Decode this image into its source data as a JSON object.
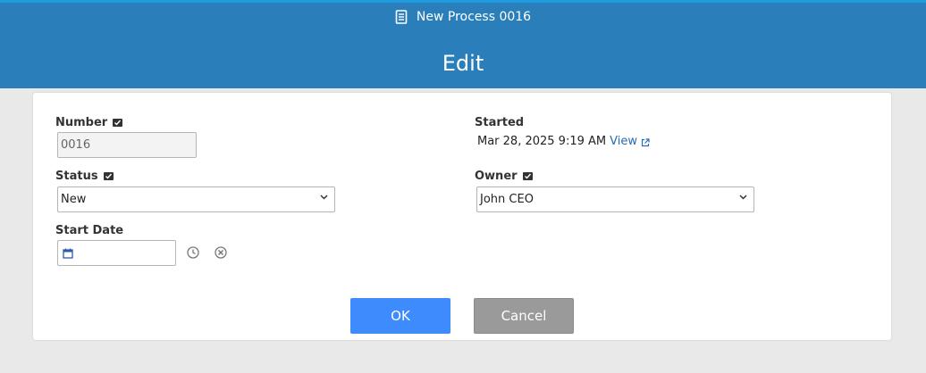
{
  "header": {
    "process_title": "New Process 0016",
    "page_title": "Edit"
  },
  "form": {
    "number": {
      "label": "Number",
      "value": "0016"
    },
    "started": {
      "label": "Started",
      "value": "Mar 28, 2025 9:19 AM",
      "link": "View"
    },
    "status": {
      "label": "Status",
      "value": "New"
    },
    "owner": {
      "label": "Owner",
      "value": "John CEO"
    },
    "start_date": {
      "label": "Start Date",
      "value": ""
    }
  },
  "buttons": {
    "ok": "OK",
    "cancel": "Cancel"
  },
  "colors": {
    "header": "#2a7fba",
    "ok_button": "#3d8bfd",
    "cancel_button": "#9a9a9a",
    "link": "#2a6bb0"
  }
}
